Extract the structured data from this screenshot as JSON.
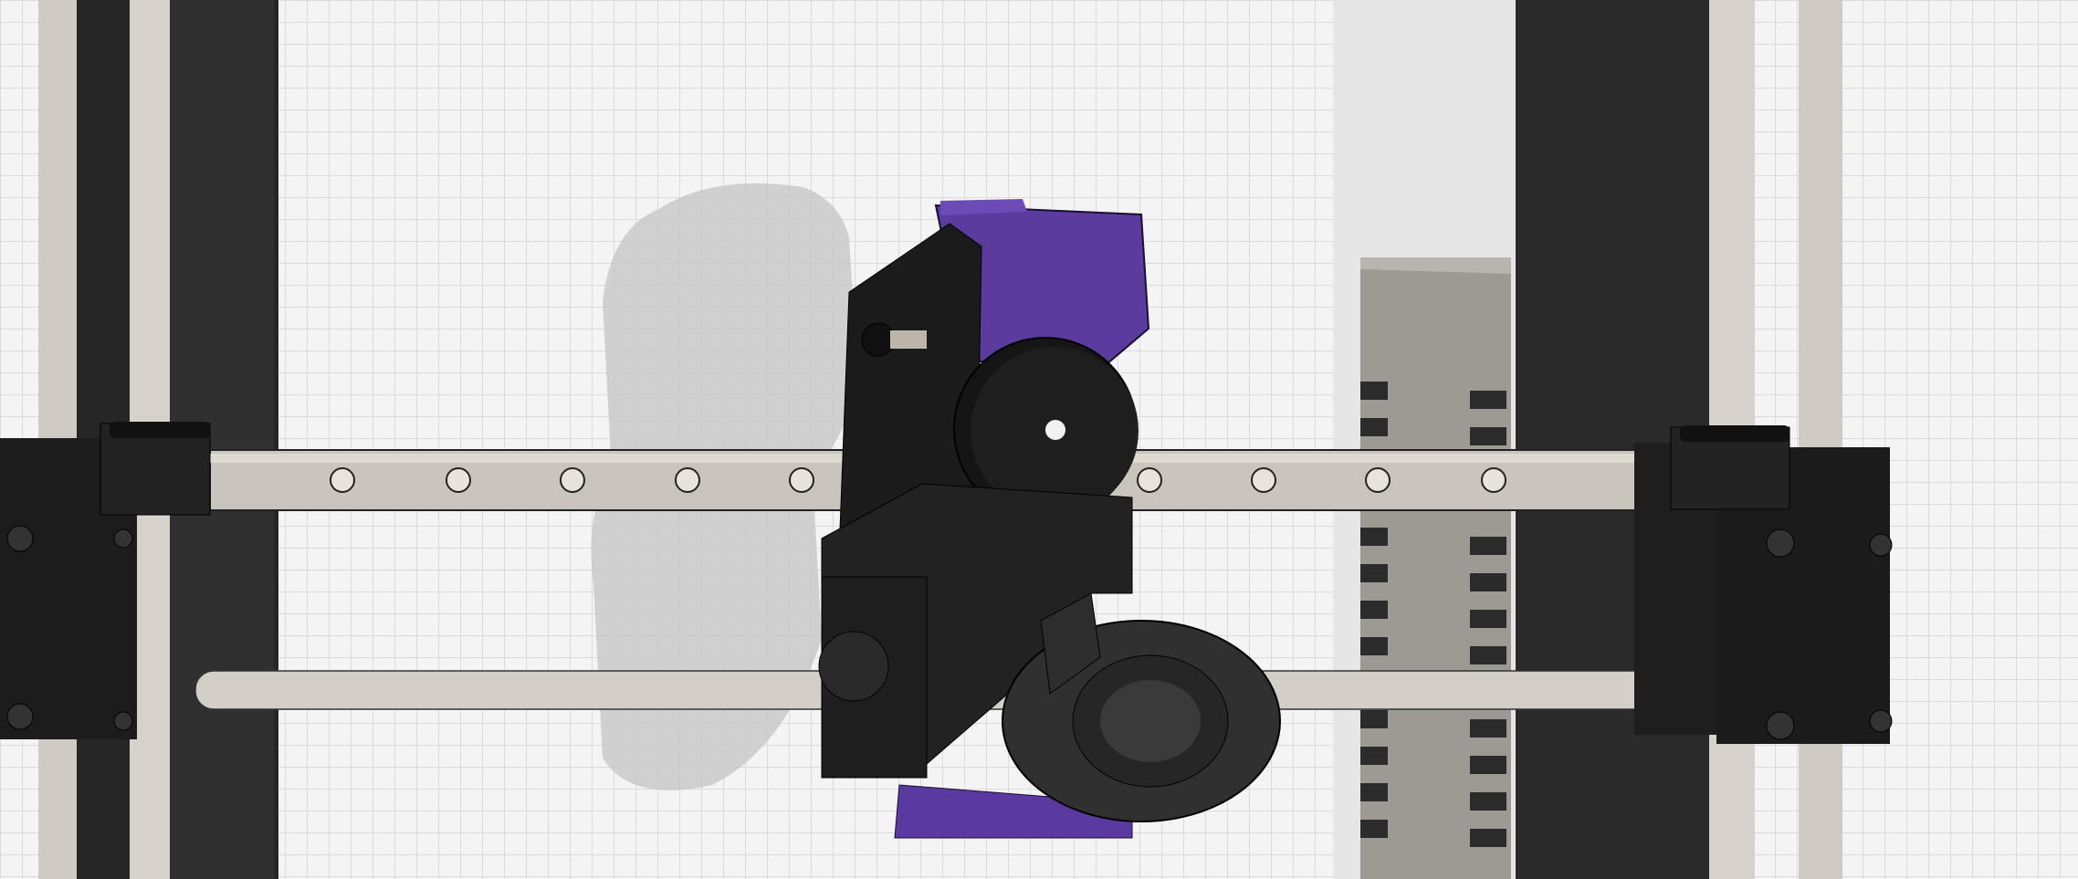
{
  "viewport": {
    "background": "#f4f4f4",
    "grid_color": "#d9dcdf"
  },
  "colors": {
    "frame_dark": "#2b2b2b",
    "frame_darker": "#1d1d1d",
    "rod": "#cfcbc2",
    "rail": "#c7c3ba",
    "part_black": "#1a1a1a",
    "part_gray": "#3a3a3a",
    "accent_purple": "#5a3aa0",
    "bracket_gray": "#9a9890",
    "shadow": "#bdbdbd"
  },
  "icons": [
    "gear-icon",
    "fan-icon",
    "screw-icon"
  ]
}
